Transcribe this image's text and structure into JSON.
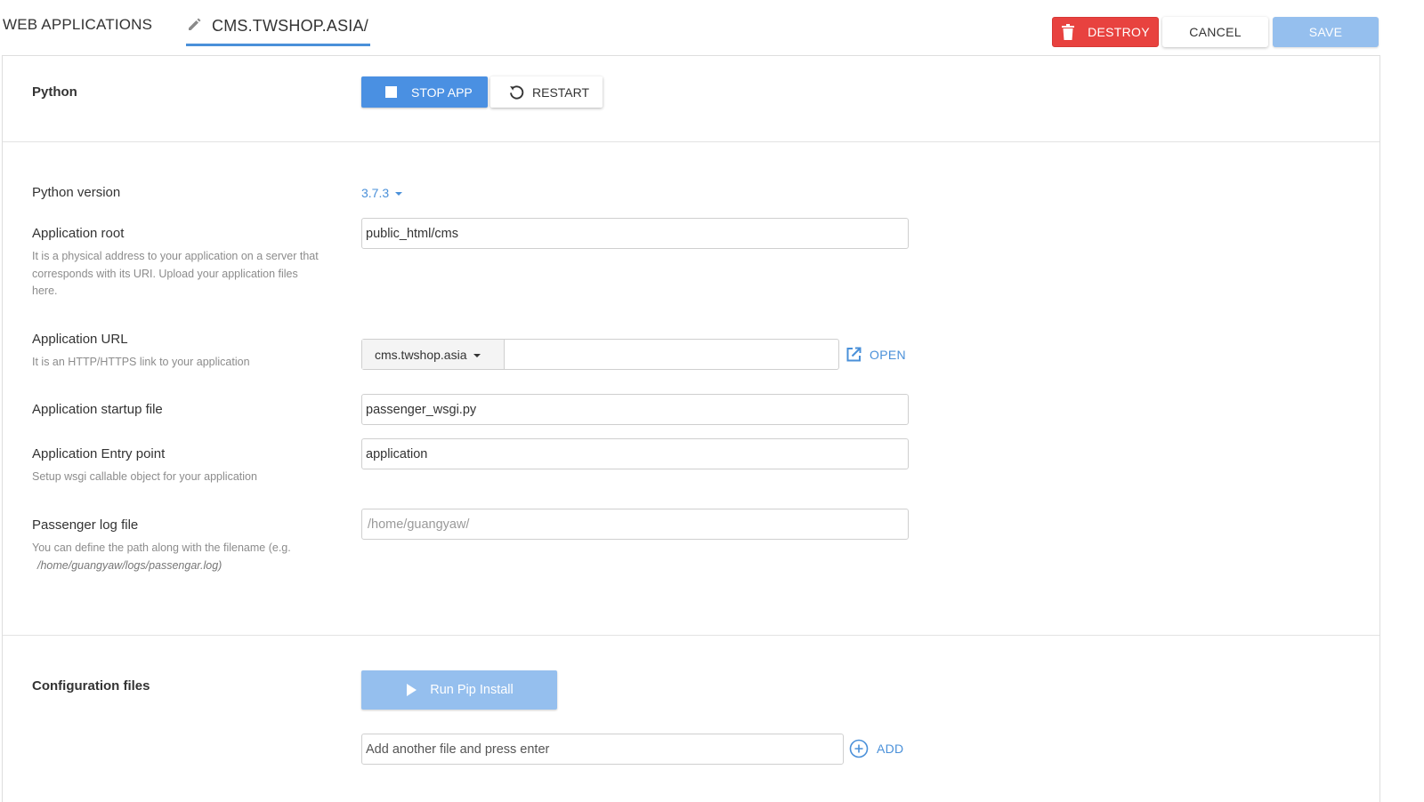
{
  "header": {
    "breadcrumb_root": "WEB APPLICATIONS",
    "current_app": "CMS.TWSHOP.ASIA/",
    "destroy_label": "DESTROY",
    "cancel_label": "CANCEL",
    "save_label": "SAVE"
  },
  "python_section": {
    "title": "Python",
    "stop_label": "STOP APP",
    "restart_label": "RESTART"
  },
  "form": {
    "python_version": {
      "label": "Python version",
      "value": "3.7.3"
    },
    "app_root": {
      "label": "Application root",
      "hint": "It is a physical address to your application on a server that corresponds with its URI. Upload your application files here.",
      "value": "public_html/cms"
    },
    "app_url": {
      "label": "Application URL",
      "hint": "It is an HTTP/HTTPS link to your application",
      "domain": "cms.twshop.asia",
      "path": "",
      "open_label": "OPEN"
    },
    "startup_file": {
      "label": "Application startup file",
      "value": "passenger_wsgi.py"
    },
    "entry_point": {
      "label": "Application Entry point",
      "hint": "Setup wsgi callable object for your application",
      "value": "application"
    },
    "log_file": {
      "label": "Passenger log file",
      "hint": "You can define the path along with the filename (e.g.",
      "hint_path": "/home/guangyaw/logs/passengar.log)",
      "placeholder": "/home/guangyaw/"
    }
  },
  "config_section": {
    "title": "Configuration files",
    "pip_label": "Run Pip Install",
    "add_placeholder": "Add another file and press enter",
    "add_label": "ADD"
  },
  "colors": {
    "accent": "#4a90d9",
    "destroy": "#e8423f",
    "save_disabled": "#95bfee"
  },
  "icons": [
    "pencil-icon",
    "trash-icon",
    "stop-icon",
    "restart-icon",
    "caret-down-icon",
    "external-link-icon",
    "play-icon",
    "plus-circle-icon"
  ]
}
